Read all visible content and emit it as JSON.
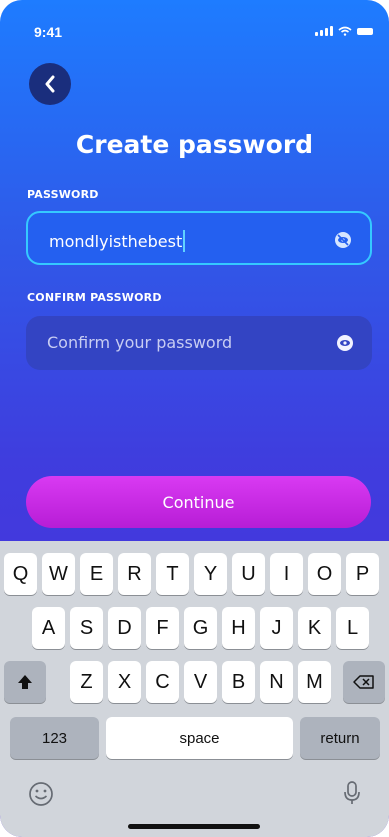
{
  "status_bar": {
    "time": "9:41"
  },
  "screen": {
    "title": "Create password",
    "password_label": "PASSWORD",
    "password_value": "mondlyisthebest",
    "confirm_label": "CONFIRM PASSWORD",
    "confirm_placeholder": "Confirm your password",
    "continue_label": "Continue"
  },
  "keyboard": {
    "row1": [
      "Q",
      "W",
      "E",
      "R",
      "T",
      "Y",
      "U",
      "I",
      "O",
      "P"
    ],
    "row2": [
      "A",
      "S",
      "D",
      "F",
      "G",
      "H",
      "J",
      "K",
      "L"
    ],
    "row3": [
      "Z",
      "X",
      "C",
      "V",
      "B",
      "N",
      "M"
    ],
    "numbers_label": "123",
    "space_label": "space",
    "return_label": "return"
  },
  "icons": {
    "back": "chevron-left-icon",
    "password_visibility": "eye-slash-icon",
    "confirm_visibility": "eye-icon",
    "shift": "shift-arrow-icon",
    "delete": "backspace-icon",
    "emoji": "emoji-icon",
    "mic": "microphone-icon"
  },
  "colors": {
    "accent": "#35c9ff",
    "button": "#c92ae4",
    "background_top": "#1e7cff",
    "background_bottom": "#4f2ad8"
  }
}
